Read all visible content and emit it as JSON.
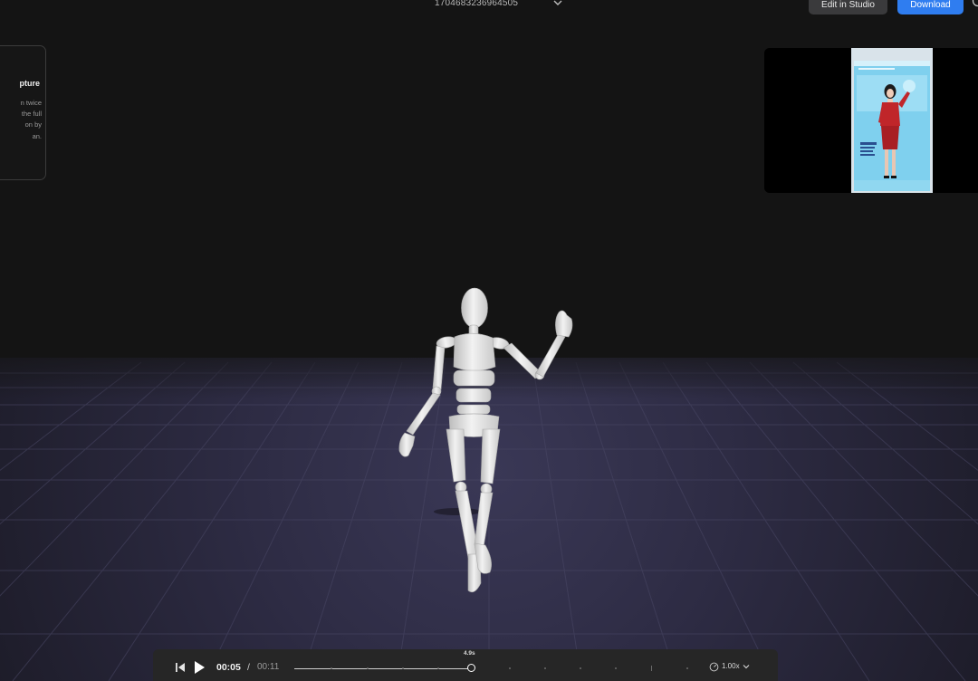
{
  "header": {
    "file_title": "1704683236964505",
    "edit_button_label": "Edit in Studio",
    "download_button_label": "Download"
  },
  "info_card": {
    "title": "pture",
    "lines": [
      "n twice",
      "the full",
      "on by",
      "an."
    ]
  },
  "player": {
    "current_time": "00:05",
    "separator": "/",
    "total_time": "00:11",
    "playhead_label": "4.9s",
    "progress": 0.445,
    "speed_label": "1.00x"
  },
  "colors": {
    "accent": "#2f7df0",
    "background": "#141414",
    "floor": "#2e2c45",
    "figure": "#e6e6e6",
    "reference_dress": "#c0262a"
  },
  "icons": {
    "title_dropdown": "chevron-down-icon",
    "help": "help-circle-icon",
    "previous": "skip-back-icon",
    "play": "play-icon",
    "speed": "gauge-icon",
    "speed_dropdown": "chevron-down-icon"
  }
}
